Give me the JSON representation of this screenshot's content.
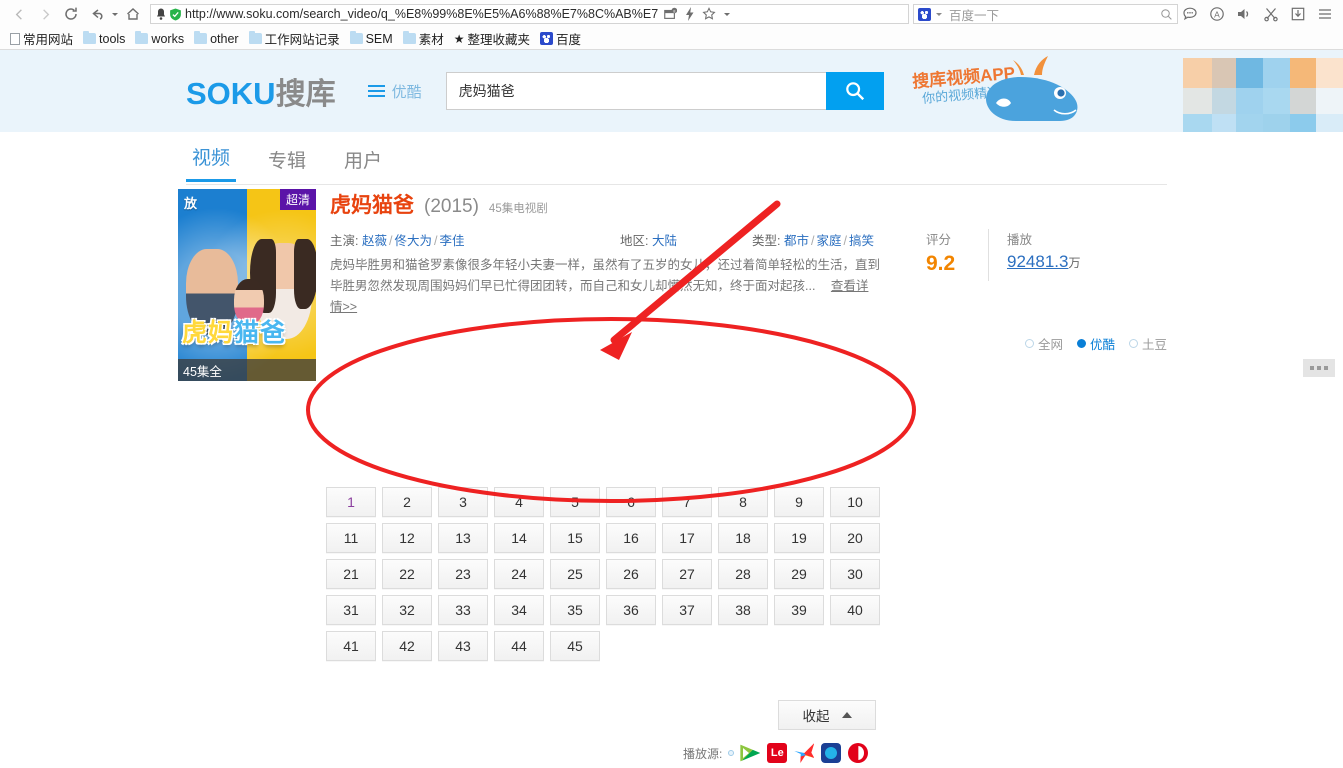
{
  "browser": {
    "url": "http://www.soku.com/search_video/q_%E8%99%8E%E5%A6%88%E7%8C%AB%E7",
    "search_placeholder": "百度一下",
    "nav": {
      "back": "back-arrow",
      "forward": "forward-arrow",
      "reload": "reload",
      "undo": "undo",
      "home": "home"
    },
    "bookmarks": [
      {
        "label": "常用网站",
        "icon": "page-icon"
      },
      {
        "label": "tools",
        "icon": "folder-icon"
      },
      {
        "label": "works",
        "icon": "folder-icon"
      },
      {
        "label": "other",
        "icon": "folder-icon"
      },
      {
        "label": "工作网站记录",
        "icon": "folder-icon"
      },
      {
        "label": "SEM",
        "icon": "folder-icon"
      },
      {
        "label": "素材",
        "icon": "folder-icon"
      },
      {
        "label": "整理收藏夹",
        "icon": "star-icon"
      },
      {
        "label": "百度",
        "icon": "baidu-icon"
      }
    ],
    "toolbar_icons": [
      "chat-icon",
      "circled-a-icon",
      "speaker-icon",
      "scissors-icon",
      "download-icon",
      "menu-icon"
    ]
  },
  "site": {
    "logo_en": "SOKU",
    "logo_cn": "搜库",
    "youku_label": "优酷",
    "search_value": "虎妈猫爸",
    "search_button_icon": "search-icon",
    "promo_line1": "搜库视频APP",
    "promo_line2": "你的视频精选集"
  },
  "tabs": [
    {
      "label": "视频",
      "active": true
    },
    {
      "label": "专辑",
      "active": false
    },
    {
      "label": "用户",
      "active": false
    }
  ],
  "site_filter": [
    {
      "label": "全网",
      "selected": false
    },
    {
      "label": "优酷",
      "selected": true
    },
    {
      "label": "土豆",
      "selected": false
    }
  ],
  "result": {
    "poster": {
      "badge_quality": "超清",
      "brand": "放",
      "title_art_1": "虎妈",
      "title_art_2": "猫爸",
      "footer": "45集全"
    },
    "title": "虎妈猫爸",
    "year": "(2015)",
    "type_text": "45集电视剧",
    "actors_label": "主演:",
    "actors": [
      "赵薇",
      "佟大为",
      "李佳"
    ],
    "region_label": "地区:",
    "region": "大陆",
    "genre_label": "类型:",
    "genres": [
      "都市",
      "家庭",
      "搞笑"
    ],
    "description": "虎妈毕胜男和猫爸罗素像很多年轻小夫妻一样，虽然有了五岁的女儿，还过着简单轻松的生活，直到毕胜男忽然发现周围妈妈们早已忙得团团转，而自己和女儿却懵然无知，终于面对起孩...",
    "detail_link": "查看详情>>",
    "score_label": "评分",
    "score_value": "9.2",
    "plays_label": "播放",
    "plays_value": "92481.3",
    "plays_unit": "万",
    "episodes": [
      "1",
      "2",
      "3",
      "4",
      "5",
      "6",
      "7",
      "8",
      "9",
      "10",
      "11",
      "12",
      "13",
      "14",
      "15",
      "16",
      "17",
      "18",
      "19",
      "20",
      "21",
      "22",
      "23",
      "24",
      "25",
      "26",
      "27",
      "28",
      "29",
      "30",
      "31",
      "32",
      "33",
      "34",
      "35",
      "36",
      "37",
      "38",
      "39",
      "40",
      "41",
      "42",
      "43",
      "44",
      "45"
    ],
    "visited_episodes": [
      "1"
    ],
    "collapse_label": "收起",
    "sources_label": "播放源:",
    "sources": [
      "youku-icon",
      "youku-green-icon",
      "letv-icon",
      "iqiyi-icon",
      "pptv-icon",
      "sohu-icon"
    ],
    "letv_text": "Le"
  },
  "annotation": {
    "arrow_color": "#ee2222",
    "ellipse_color": "#ee2222"
  }
}
